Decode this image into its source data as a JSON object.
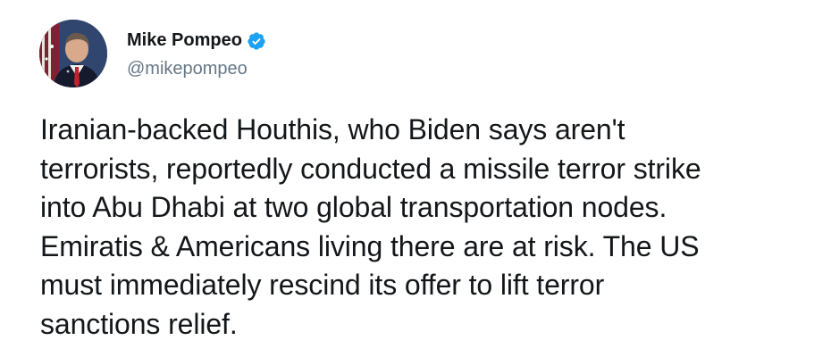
{
  "tweet": {
    "author": {
      "display_name": "Mike Pompeo",
      "handle": "@mikepompeo",
      "verified": true
    },
    "text": "Iranian-backed Houthis, who Biden says aren't\nterrorists, reportedly conducted a missile terror strike\ninto Abu Dhabi at two global transportation nodes.\nEmiratis & Americans living there are at risk. The US\nmust immediately rescind its offer to lift terror\nsanctions relief."
  },
  "colors": {
    "text": "#14171a",
    "secondary_text": "#657786",
    "verified_badge": "#1da1f2",
    "background": "#ffffff"
  },
  "icons": {
    "avatar": "profile-photo",
    "badge": "verified-badge-icon"
  }
}
